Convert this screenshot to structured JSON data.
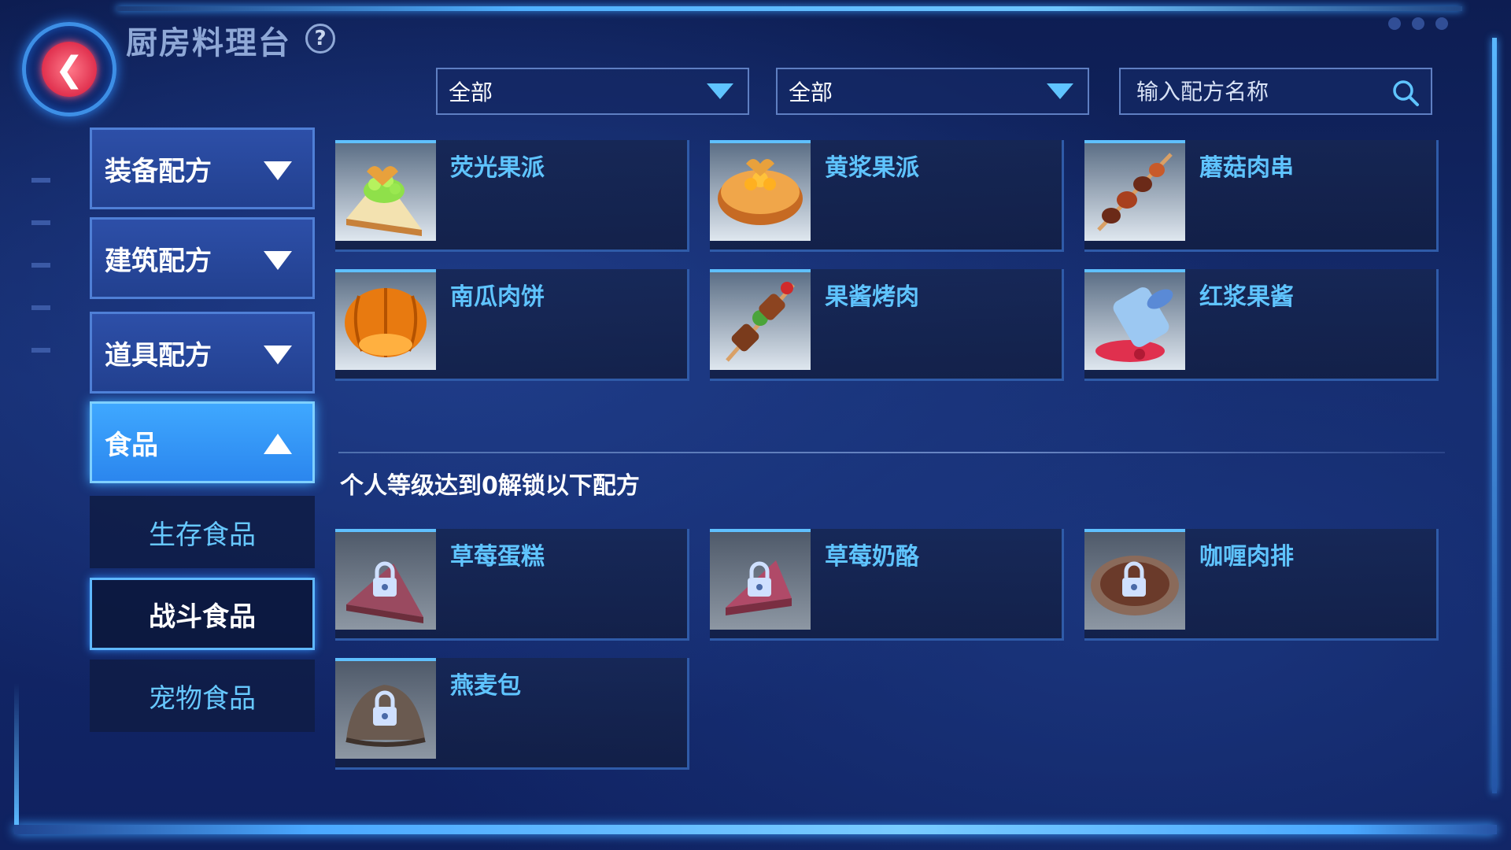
{
  "header": {
    "title": "厨房料理台",
    "help": "?"
  },
  "filters": {
    "filter1": "全部",
    "filter2": "全部",
    "search_placeholder": "输入配方名称"
  },
  "sidebar": {
    "categories": [
      {
        "label": "装备配方"
      },
      {
        "label": "建筑配方"
      },
      {
        "label": "道具配方"
      },
      {
        "label": "食品"
      }
    ],
    "subcategories": [
      {
        "label": "生存食品"
      },
      {
        "label": "战斗食品"
      },
      {
        "label": "宠物食品"
      }
    ]
  },
  "recipes": [
    {
      "name": "荧光果派",
      "icon": "glowing-fruit-pie-icon"
    },
    {
      "name": "黄浆果派",
      "icon": "yellow-berry-pie-icon"
    },
    {
      "name": "蘑菇肉串",
      "icon": "mushroom-skewer-icon"
    },
    {
      "name": "南瓜肉饼",
      "icon": "pumpkin-meat-pie-icon"
    },
    {
      "name": "果酱烤肉",
      "icon": "jam-roast-meat-icon"
    },
    {
      "name": "红浆果酱",
      "icon": "red-berry-jam-icon"
    }
  ],
  "locked_section": {
    "title": "个人等级达到0解锁以下配方",
    "recipes": [
      {
        "name": "草莓蛋糕",
        "icon": "strawberry-cake-icon"
      },
      {
        "name": "草莓奶酪",
        "icon": "strawberry-cheese-icon"
      },
      {
        "name": "咖喱肉排",
        "icon": "curry-steak-icon"
      },
      {
        "name": "燕麦包",
        "icon": "oat-bread-icon"
      }
    ]
  },
  "colors": {
    "accent": "#5fc4ff",
    "active_tab": "#3fa8ff",
    "back_button": "#e0304e"
  }
}
